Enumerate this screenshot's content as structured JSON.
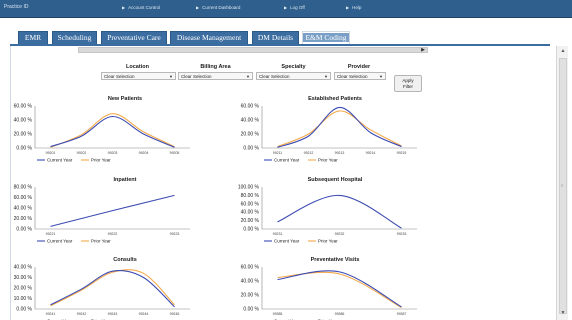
{
  "topbar": {
    "brand": "Practice ID",
    "nav": [
      {
        "label": "Account Control"
      },
      {
        "label": "Current Dashboard"
      },
      {
        "label": "Log Off"
      },
      {
        "label": "Help"
      }
    ]
  },
  "tabs": [
    {
      "label": "EMR"
    },
    {
      "label": "Scheduling"
    },
    {
      "label": "Preventative Care"
    },
    {
      "label": "Disease Management"
    },
    {
      "label": "DM Details"
    },
    {
      "label": "E&M Coding"
    }
  ],
  "active_tab": "E&M Coding",
  "filters": [
    {
      "label": "Location",
      "value": "Clear Selection"
    },
    {
      "label": "Billing Area",
      "value": "Clear Selection"
    },
    {
      "label": "Specialty",
      "value": "Clear Selection"
    },
    {
      "label": "Provider",
      "value": "Clear Selection"
    }
  ],
  "apply_button": {
    "line1": "Apply",
    "line2": "Filter"
  },
  "legend_labels": {
    "current": "Current Year",
    "prior": "Prior Year"
  },
  "colors": {
    "current": "#3b4bb3",
    "prior": "#f4a94a",
    "header": "#2f5f8d",
    "tab": "#3c6da0"
  },
  "chart_data": [
    {
      "id": "new-patients",
      "type": "line",
      "title": "New Patients",
      "x": [
        "99201",
        "99202",
        "99203",
        "99204",
        "99205"
      ],
      "yticks": [
        "0.00 %",
        "20.00 %",
        "40.00 %",
        "60.00 %"
      ],
      "ylim": [
        0,
        60
      ],
      "series": [
        {
          "name": "Current Year",
          "values": [
            2,
            17,
            45,
            20,
            1
          ]
        },
        {
          "name": "Prior Year",
          "values": [
            1,
            19,
            49,
            23,
            2
          ]
        }
      ]
    },
    {
      "id": "established-patients",
      "type": "line",
      "title": "Established Patients",
      "x": [
        "99211",
        "99212",
        "99213",
        "99214",
        "99215"
      ],
      "yticks": [
        "0.00 %",
        "20.00 %",
        "40.00 %",
        "60.00 %"
      ],
      "ylim": [
        0,
        60
      ],
      "series": [
        {
          "name": "Current Year",
          "values": [
            1,
            17,
            58,
            22,
            2
          ]
        },
        {
          "name": "Prior Year",
          "values": [
            2,
            20,
            53,
            26,
            3
          ]
        }
      ]
    },
    {
      "id": "inpatient",
      "type": "line",
      "title": "Inpatient",
      "x": [
        "99221",
        "99222",
        "99223"
      ],
      "yticks": [
        "0.00 %",
        "20.00 %",
        "40.00 %",
        "60.00 %",
        "80.00 %"
      ],
      "ylim": [
        0,
        80
      ],
      "series": [
        {
          "name": "Current Year",
          "values": [
            5,
            35,
            64
          ]
        },
        {
          "name": "Prior Year",
          "values": [
            null,
            null,
            null
          ]
        }
      ]
    },
    {
      "id": "subsequent-hospital",
      "type": "line",
      "title": "Subsequent Hospital",
      "x": [
        "99231",
        "99232",
        "99233"
      ],
      "yticks": [
        "0.00 %",
        "20.00 %",
        "40.00 %",
        "60.00 %",
        "80.00 %",
        "100.00 %"
      ],
      "ylim": [
        0,
        100
      ],
      "series": [
        {
          "name": "Current Year",
          "values": [
            17,
            80,
            2
          ]
        },
        {
          "name": "Prior Year",
          "values": [
            null,
            null,
            null
          ]
        }
      ]
    },
    {
      "id": "consults",
      "type": "line",
      "title": "Consults",
      "x": [
        "99241",
        "99242",
        "99243",
        "99244",
        "99245"
      ],
      "yticks": [
        "0.00 %",
        "10.00 %",
        "20.00 %",
        "30.00 %",
        "40.00 %"
      ],
      "ylim": [
        0,
        40
      ],
      "series": [
        {
          "name": "Current Year",
          "values": [
            4,
            19,
            36,
            30,
            2
          ]
        },
        {
          "name": "Prior Year",
          "values": [
            3,
            18,
            35,
            34,
            4
          ]
        }
      ]
    },
    {
      "id": "preventative-visits",
      "type": "line",
      "title": "Preventative Visits",
      "x": [
        "99385",
        "99386",
        "99387"
      ],
      "yticks": [
        "0.00 %",
        "20.00 %",
        "40.00 %",
        "60.00 %"
      ],
      "ylim": [
        0,
        60
      ],
      "series": [
        {
          "name": "Current Year",
          "values": [
            42,
            53,
            3
          ]
        },
        {
          "name": "Prior Year",
          "values": [
            45,
            50,
            2
          ]
        }
      ]
    }
  ]
}
